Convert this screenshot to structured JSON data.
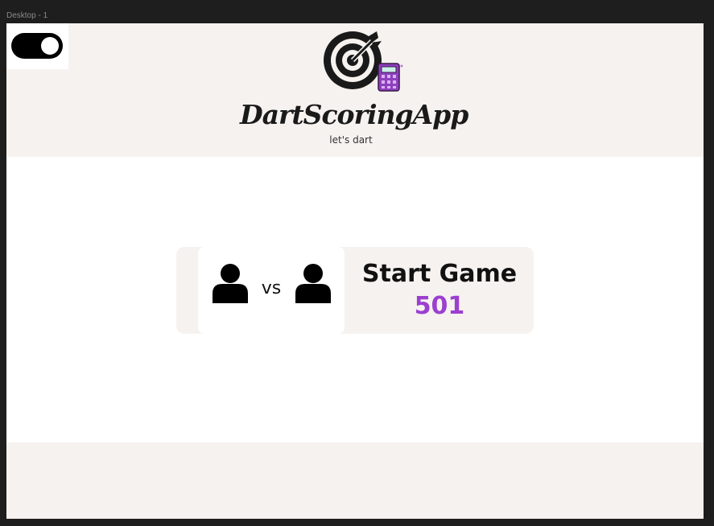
{
  "editor": {
    "frame_label": "Desktop - 1"
  },
  "header": {
    "theme_toggle": {
      "state": "on",
      "icon": "toggle-switch-icon"
    },
    "logo": {
      "title": "DartScoringApp",
      "tagline": "let's dart",
      "icons": [
        "dartboard-target-icon",
        "calculator-icon"
      ]
    }
  },
  "game_card": {
    "player_icons": [
      "user-icon",
      "user-icon"
    ],
    "vs_label": "vs",
    "start_label": "Start Game",
    "mode_value": "501"
  },
  "colors": {
    "page_background": "#f6f2ef",
    "panel_background": "#ffffff",
    "accent": "#9b3fd1",
    "text": "#111111",
    "calculator": "#8e3fbf"
  }
}
